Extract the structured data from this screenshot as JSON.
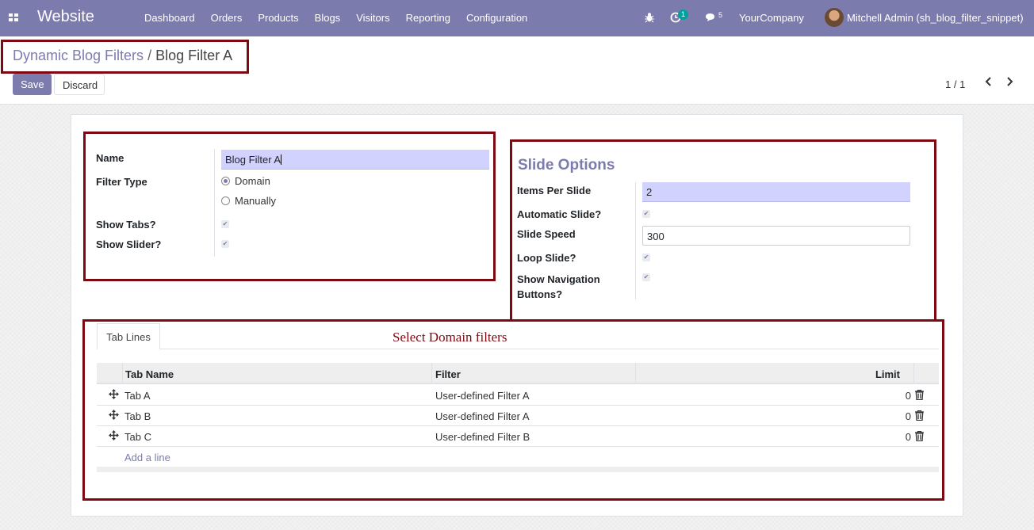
{
  "navbar": {
    "app_name": "Website",
    "menu": [
      "Dashboard",
      "Orders",
      "Products",
      "Blogs",
      "Visitors",
      "Reporting",
      "Configuration"
    ],
    "activity_count": "1",
    "messages_count": "5",
    "company": "YourCompany",
    "user": "Mitchell Admin (sh_blog_filter_snippet)",
    "icons": [
      "apps-icon",
      "bug-icon",
      "clock-icon",
      "chat-icon",
      "avatar"
    ]
  },
  "breadcrumb": {
    "parent": "Dynamic Blog Filters",
    "separator": "/",
    "current": "Blog Filter A"
  },
  "toolbar": {
    "save_label": "Save",
    "discard_label": "Discard"
  },
  "pager": {
    "value": "1 / 1"
  },
  "form": {
    "name_label": "Name",
    "name_value": "Blog Filter A",
    "filter_type_label": "Filter Type",
    "filter_type_options": [
      "Domain",
      "Manually"
    ],
    "filter_type_selected": "Domain",
    "show_tabs_label": "Show Tabs?",
    "show_tabs_value": true,
    "show_slider_label": "Show Slider?",
    "show_slider_value": true
  },
  "slide_options": {
    "title": "Slide Options",
    "items_per_slide_label": "Items Per Slide",
    "items_per_slide_value": "2",
    "automatic_slide_label": "Automatic Slide?",
    "automatic_slide_value": true,
    "slide_speed_label": "Slide Speed",
    "slide_speed_value": "300",
    "loop_slide_label": "Loop Slide?",
    "loop_slide_value": true,
    "show_nav_label": "Show Navigation Buttons?",
    "show_nav_label_line1": "Show Navigation",
    "show_nav_label_line2": "Buttons?",
    "show_nav_value": true
  },
  "annotation": "Select Domain filters",
  "tabs": [
    {
      "label": "Tab Lines"
    }
  ],
  "table": {
    "headers": {
      "name": "Tab Name",
      "filter": "Filter",
      "limit": "Limit"
    },
    "rows": [
      {
        "name": "Tab A",
        "filter": "User-defined Filter A",
        "limit": "0"
      },
      {
        "name": "Tab B",
        "filter": "User-defined Filter A",
        "limit": "0"
      },
      {
        "name": "Tab C",
        "filter": "User-defined Filter B",
        "limit": "0"
      }
    ],
    "add_line": "Add a line"
  },
  "colors": {
    "brand": "#7c7bad",
    "annotation_border": "#7d0a13",
    "required_input": "#d2d2ff",
    "badge": "#00a09d"
  }
}
